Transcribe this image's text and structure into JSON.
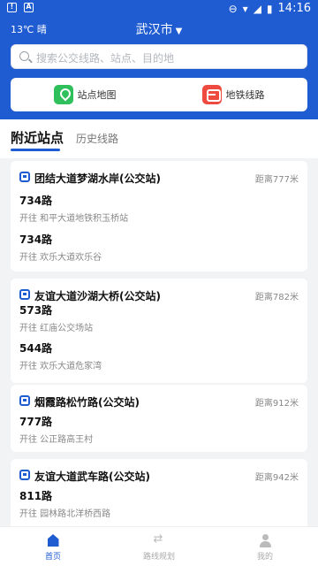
{
  "status_bar": {
    "time": "14:16"
  },
  "header": {
    "weather": "13℃ 晴",
    "city": "武汉市"
  },
  "search": {
    "placeholder": "搜索公交线路、站点、目的地"
  },
  "quick_actions": [
    {
      "label": "站点地图",
      "icon": "map-pin-icon",
      "color": "#2fbf5b"
    },
    {
      "label": "地铁线路",
      "icon": "metro-icon",
      "color": "#ef4a3f"
    }
  ],
  "tabs": {
    "active": "附近站点",
    "inactive": "历史线路"
  },
  "stations": [
    {
      "name": "团结大道梦湖水岸(公交站)",
      "distance": "距离777米",
      "routes": [
        {
          "number": "734路",
          "direction": "开往 和平大道地铁积玉桥站"
        },
        {
          "number": "734路",
          "direction": "开往 欢乐大道欢乐谷"
        }
      ]
    },
    {
      "name": "友谊大道沙湖大桥(公交站)",
      "distance": "距离782米",
      "routes": [
        {
          "number": "573路",
          "direction": "开往 红庙公交场站"
        },
        {
          "number": "544路",
          "direction": "开往 欢乐大道危家湾"
        }
      ]
    },
    {
      "name": "烟霞路松竹路(公交站)",
      "distance": "距离912米",
      "routes": [
        {
          "number": "777路",
          "direction": "开往 公正路高王村"
        }
      ]
    },
    {
      "name": "友谊大道武车路(公交站)",
      "distance": "距离942米",
      "routes": [
        {
          "number": "811路",
          "direction": "开往 园林路北洋桥西路"
        }
      ]
    }
  ],
  "tabbar": [
    {
      "label": "首页"
    },
    {
      "label": "路线规划"
    },
    {
      "label": "我的"
    }
  ],
  "colors": {
    "primary": "#1f5bd1"
  }
}
